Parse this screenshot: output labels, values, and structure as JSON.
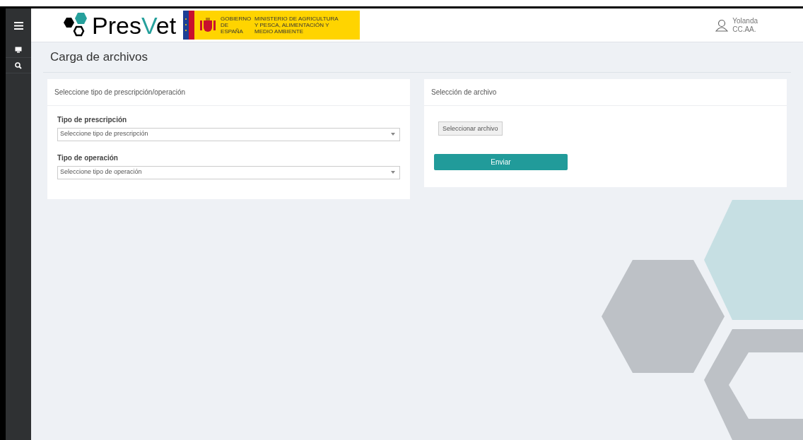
{
  "header": {
    "logo_parts": [
      "Pres",
      "V",
      "et"
    ],
    "gov_text": "GOBIERNO DE ESPAÑA",
    "ministry_text": "MINISTERIO DE AGRICULTURA Y PESCA, ALIMENTACIÓN Y MEDIO AMBIENTE",
    "user": {
      "name": "Yolanda",
      "role": "CC.AA."
    }
  },
  "sidebar": {
    "items": [
      {
        "kind": "monitor"
      },
      {
        "kind": "search"
      }
    ]
  },
  "page_title": "Carga de archivos",
  "panels": [
    {
      "title": "Seleccione tipo de prescripción/operación",
      "fields": [
        {
          "label": "Tipo de prescripción",
          "placeholder": "Seleccione tipo de prescripción"
        },
        {
          "label": "Tipo de operación",
          "placeholder": "Seleccione tipo de operación"
        }
      ]
    },
    {
      "title": "Selección de archivo",
      "file_button": "Seleccionar archivo",
      "submit": "Enviar"
    }
  ]
}
